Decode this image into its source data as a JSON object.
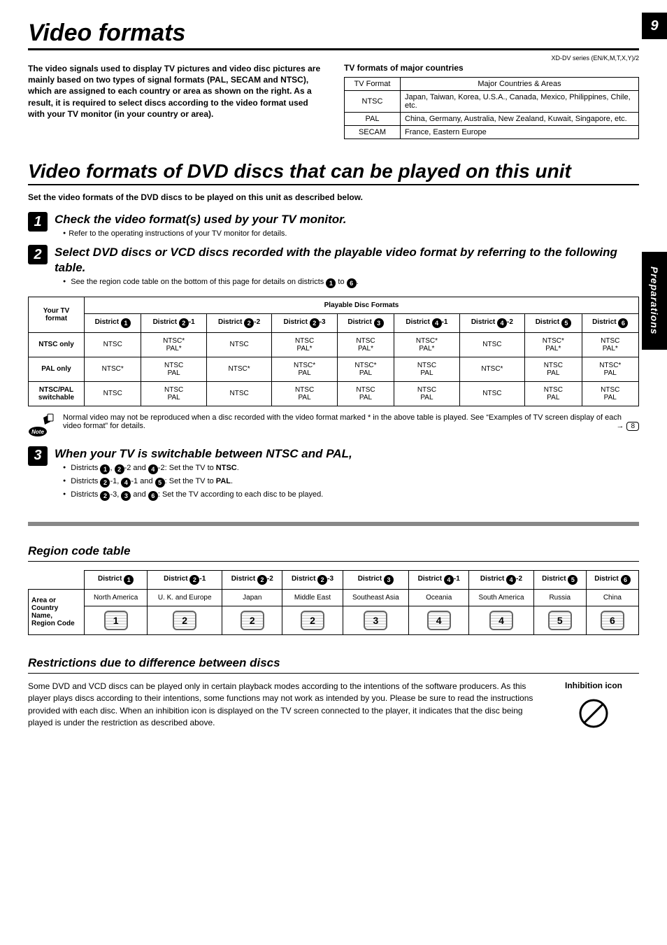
{
  "page": {
    "number": "9",
    "series": "XD-DV series (EN/K,M,T,X,Y)/2",
    "side_tab": "Preparations"
  },
  "section1": {
    "title": "Video formats",
    "intro": "The video signals used to display TV pictures and video disc pictures are mainly based on two types of signal formats (PAL, SECAM and NTSC), which are assigned to each country or area as shown on the right. As a result, it is required to select discs according to the video format used with your TV monitor (in your country or area).",
    "tv_table_title": "TV formats of major countries",
    "tv_table_h1": "TV Format",
    "tv_table_h2": "Major Countries & Areas",
    "tv_rows": [
      {
        "fmt": "NTSC",
        "areas": "Japan, Taiwan, Korea, U.S.A., Canada, Mexico, Philippines, Chile, etc."
      },
      {
        "fmt": "PAL",
        "areas": "China, Germany, Australia, New Zealand, Kuwait, Singapore, etc."
      },
      {
        "fmt": "SECAM",
        "areas": "France, Eastern Europe"
      }
    ]
  },
  "section2": {
    "title": "Video formats of DVD discs that can be played on this unit",
    "set": "Set the video formats of the DVD discs to be played on this unit as described below.",
    "step1_title": "Check the video format(s) used by your TV monitor.",
    "step1_b": "Refer to the operating instructions of your TV monitor for details.",
    "step2_title": "Select DVD discs or VCD discs recorded with the playable video format by referring to the following table.",
    "step2_b_pre": "See the region code table on the bottom of this page for details on districts ",
    "step2_b_mid": " to ",
    "step2_b_end": ".",
    "d_1": "1",
    "d_6": "6",
    "playable_header_main": "Playable Disc Formats",
    "playable_yourtv": "Your TV format",
    "districts": [
      "District 1",
      "District 2-1",
      "District 2-2",
      "District 2-3",
      "District 3",
      "District 4-1",
      "District 4-2",
      "District 5",
      "District 6"
    ],
    "rows": [
      {
        "h": "NTSC only",
        "c": [
          "NTSC",
          "NTSC*\nPAL*",
          "NTSC",
          "NTSC\nPAL*",
          "NTSC\nPAL*",
          "NTSC*\nPAL*",
          "NTSC",
          "NTSC*\nPAL*",
          "NTSC\nPAL*"
        ]
      },
      {
        "h": "PAL only",
        "c": [
          "NTSC*",
          "NTSC\nPAL",
          "NTSC*",
          "NTSC*\nPAL",
          "NTSC*\nPAL",
          "NTSC\nPAL",
          "NTSC*",
          "NTSC\nPAL",
          "NTSC*\nPAL"
        ]
      },
      {
        "h": "NTSC/PAL switchable",
        "c": [
          "NTSC",
          "NTSC\nPAL",
          "NTSC",
          "NTSC\nPAL",
          "NTSC\nPAL",
          "NTSC\nPAL",
          "NTSC",
          "NTSC\nPAL",
          "NTSC\nPAL"
        ]
      }
    ],
    "note_text": "Normal video may not be reproduced when a disc recorded with the video format marked * in the above table is played. See “Examples of TV screen display of each video format” for details.",
    "note_page_ref": "8",
    "note_label": "Note",
    "step3_title": "When your TV is switchable between NTSC and PAL,",
    "step3_l1_pre": "Districts ",
    "step3_l1_mid1": ", ",
    "step3_l1_mid2": "-2 and ",
    "step3_l1_mid3": "-2: Set the TV to ",
    "step3_l1_b": "NTSC",
    "step3_l1_end": ".",
    "step3_l2_pre": "Districts ",
    "step3_l2_mid1": "-1, ",
    "step3_l2_mid2": "-1 and ",
    "step3_l2_mid3": ": Set the TV to ",
    "step3_l2_b": "PAL",
    "step3_l2_end": ".",
    "step3_l3_pre": "Districts ",
    "step3_l3_mid1": "-3, ",
    "step3_l3_mid2": " and ",
    "step3_l3_mid3": ":  Set the TV according to each disc to be played."
  },
  "region": {
    "title": "Region code table",
    "row_h1": "Area or Country Name,",
    "row_h2": "Region Code",
    "districts": [
      "District 1",
      "District 2-1",
      "District 2-2",
      "District 2-3",
      "District 3",
      "District 4-1",
      "District 4-2",
      "District 5",
      "District 6"
    ],
    "areas": [
      "North America",
      "U. K. and Europe",
      "Japan",
      "Middle East",
      "Southeast Asia",
      "Oceania",
      "South America",
      "Russia",
      "China"
    ],
    "codes": [
      "1",
      "2",
      "2",
      "2",
      "3",
      "4",
      "4",
      "5",
      "6"
    ]
  },
  "restrict": {
    "title": "Restrictions due to difference between discs",
    "text": "Some DVD and VCD discs can be played only in certain playback modes according to the intentions of the software producers. As this player plays discs according to their intentions, some functions may not work as intended by you. Please be sure to read the instructions provided with each disc. When an inhibition icon is displayed on the TV screen connected to the player, it indicates that the disc being played is under the restriction as described above.",
    "inhib_title": "Inhibition icon"
  },
  "c": {
    "n1": "1",
    "n2": "2",
    "n3": "3",
    "n4": "4",
    "n5": "5",
    "n6": "6"
  }
}
